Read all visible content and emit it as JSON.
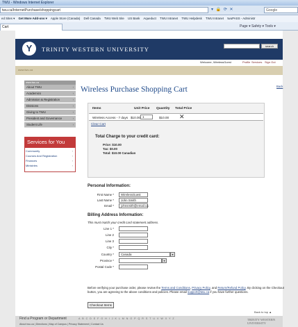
{
  "browser": {
    "title": "TWU - Windows Internet Explorer",
    "url": "twu.ca/InternetPurchase/shoppingcart",
    "search_placeholder": "Google",
    "favorites": [
      "ed Sites ▾",
      "Get More Add-ons ▾",
      "Apple Store (Canada)",
      "Dell Canada",
      "TWU Web Site",
      "US Bank",
      "Aqueduct",
      "TWU Intranet",
      "TWU Helpdesk",
      "TWU Intranet",
      "twuPASS - Administr"
    ],
    "tab_label": "Cart",
    "tools": "Page ▾  Safety ▾  Tools ▾"
  },
  "site": {
    "university_name": "TRINITY WESTERN UNIVERSITY",
    "search_button": "search",
    "welcome": "Welcome, WirelessGuest",
    "links": {
      "profile": "Profile",
      "services": "Services",
      "signout": "Sign Out"
    },
    "strip_label": "www.twu.ca"
  },
  "sidebar": {
    "header": "www.twu.ca",
    "items": [
      "About TWU",
      "Academics",
      "Admission & Registration",
      "Divisions",
      "Giving to TWU",
      "President and Governance",
      "Student Life"
    ]
  },
  "services": {
    "title": "Services for You",
    "items": [
      "Community",
      "Courses And Registration",
      "Finances",
      "Ministries"
    ]
  },
  "cart": {
    "back": "Back",
    "title": "Wireless Purchase Shopping Cart",
    "headers": {
      "items": "Items",
      "unit_price": "Unit Price",
      "quantity": "Quantity",
      "total_price": "Total Price"
    },
    "row": {
      "item": "Wireless Access - 7 days",
      "unit_price": "$10.00",
      "quantity": "1",
      "total": "$10.00"
    },
    "clear": "Clear Cart",
    "charge_title": "Total Charge to your credit card:",
    "price": "Price: $10.00",
    "tax": "Tax:   $0.00",
    "total": "Total: $10.00 Canadian"
  },
  "personal": {
    "title": "Personal Information:",
    "first_name_label": "First Name *",
    "first_name": "WirelessGuest",
    "last_name_label": "Last Name *",
    "last_name": "John Smith",
    "email_label": "Email *",
    "email": "johnsmith@email.ca"
  },
  "billing": {
    "title": "Billing Address Information:",
    "note": "This must match your credit card statement address.",
    "line1_label": "Line 1 *",
    "line2_label": "Line 2",
    "line3_label": "Line 3",
    "city_label": "City *",
    "country_label": "Country *",
    "country": "Canada",
    "province_label": "Province *",
    "postal_label": "Postal Code *"
  },
  "policy": {
    "text1": "Before verifying your purchase order, please review the ",
    "terms": "Terms and Conditions",
    "sep1": ", ",
    "privacy": "Privacy Policy",
    "text2": ", and ",
    "refund": "Return/Refund Policy",
    "text3": ". By clicking on the Checkout button, you are agreeing to the above conditions and policies. Please email ",
    "email": "support@twu.ca",
    "text4": " if you have further questions."
  },
  "checkout_button": "Checkout Items",
  "footer": {
    "back_to_top": "Back to top ▲",
    "find": "Find a Program or Department",
    "alphabet": "A B C D E F G H I J K L M N O P Q R S T U V W X Y Z",
    "about": "About twu.ca | Directions | Map of Campus | Privacy Statement | Contact Us",
    "logo": "TRINITY WESTERN UNIVERSITY"
  }
}
